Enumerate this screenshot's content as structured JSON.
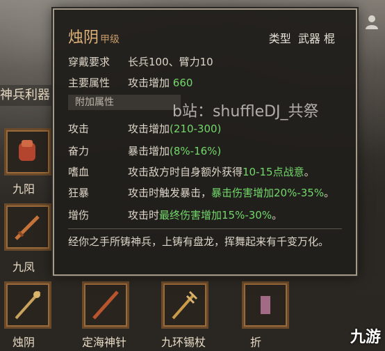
{
  "tooltip": {
    "name": "烛阴",
    "grade": "甲级",
    "type_label": "类型",
    "type_value": "武器 棍",
    "requirement_key": "穿戴要求",
    "requirement_value": "长兵100、臂力10",
    "main_attr_key": "主要属性",
    "main_attr_text": "攻击增加",
    "main_attr_value": "660",
    "extra_attr_header": "附加属性",
    "attrs": [
      {
        "key": "攻击",
        "text": "攻击增加",
        "value": "(210-300)"
      },
      {
        "key": "奋力",
        "text": "暴击增加",
        "value": "(8%-16%)"
      },
      {
        "key": "嗜血",
        "text": "攻击敌方时自身额外获得",
        "value": "10-15点战意",
        "suffix": "。"
      },
      {
        "key": "狂暴",
        "text": "攻击时触发暴击，",
        "value": "暴击伤害增加20%-35%",
        "suffix": "。"
      },
      {
        "key": "增伤",
        "text": "攻击时",
        "value": "最终伤害增加15%-30%",
        "suffix": "。"
      }
    ],
    "description": "经你之手所铸神兵，上铸有盘龙，挥舞起来有千变万化。"
  },
  "background": {
    "section_title": "神兵利器",
    "watermark": "b站：shuffleDJ_共祭",
    "brand": "九游",
    "slots_row1": [
      {
        "label": "九阳"
      }
    ],
    "slots_row2": [
      {
        "label": "九凤"
      }
    ],
    "slots_row3": [
      {
        "label": "烛阴"
      },
      {
        "label": "定海神针"
      },
      {
        "label": "九环锡杖"
      },
      {
        "label": "折"
      }
    ]
  },
  "colors": {
    "accent_name": "#e0b37a",
    "value_green": "#73d86a",
    "panel_border": "#a39a8a"
  }
}
